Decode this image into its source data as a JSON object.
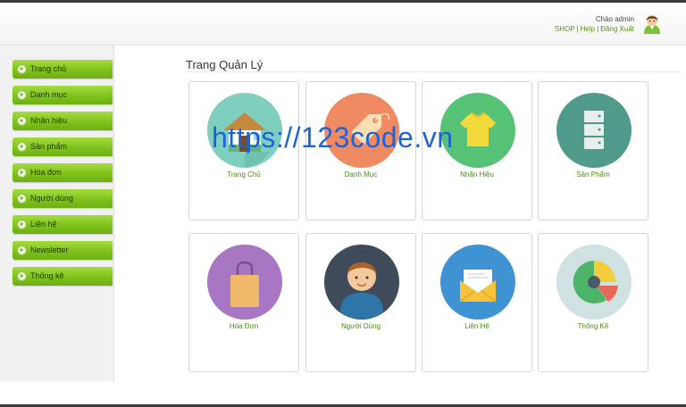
{
  "header": {
    "greeting": "Chào admin",
    "links": [
      "SHOP",
      "Help",
      "Đăng Xuất"
    ],
    "separator": "|"
  },
  "sidebar": {
    "items": [
      {
        "label": "Trang chủ"
      },
      {
        "label": "Danh mục"
      },
      {
        "label": "Nhãn hiệu"
      },
      {
        "label": "Sản phẩm"
      },
      {
        "label": "Hóa đơn"
      },
      {
        "label": "Người dùng"
      },
      {
        "label": "Liên hệ"
      },
      {
        "label": "Newsletter"
      },
      {
        "label": "Thống kê"
      }
    ]
  },
  "main": {
    "title": "Trang Quản Lý",
    "cards": [
      {
        "label": "Trang Chủ",
        "icon": "home-icon",
        "color": "#7fcfbf"
      },
      {
        "label": "Danh Mục",
        "icon": "tag-icon",
        "color": "#ef8a62"
      },
      {
        "label": "Nhãn Hiệu",
        "icon": "shirt-icon",
        "color": "#55c276"
      },
      {
        "label": "Sản Phẩm",
        "icon": "server-icon",
        "color": "#4f9a8a"
      },
      {
        "label": "Hóa Đơn",
        "icon": "shopping-bag-icon",
        "color": "#a877c4"
      },
      {
        "label": "Người Dùng",
        "icon": "user-icon",
        "color": "#3f4a5a"
      },
      {
        "label": "Liên Hệ",
        "icon": "envelope-icon",
        "color": "#3f93d2"
      },
      {
        "label": "Thống Kê",
        "icon": "pie-chart-icon",
        "color": "#cfe1e1"
      }
    ]
  },
  "watermark": "https://123code.vn",
  "colors": {
    "accent": "#7fc21c",
    "link": "#5a8f1a",
    "card_label": "#4d8c10"
  }
}
